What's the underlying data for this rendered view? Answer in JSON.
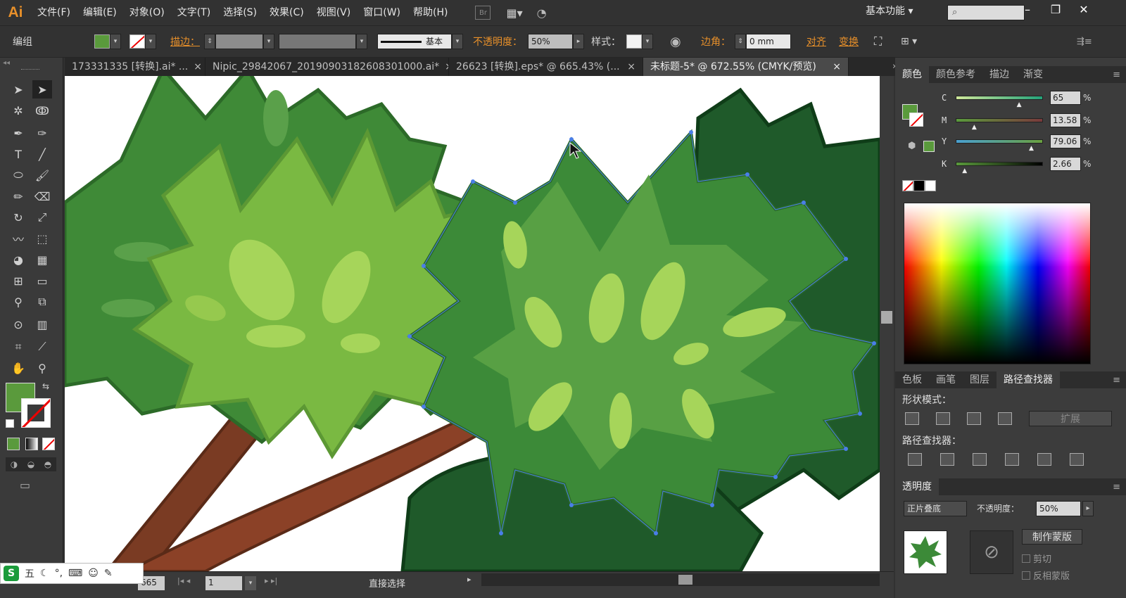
{
  "app": {
    "logo": "Ai"
  },
  "menu": [
    "文件(F)",
    "编辑(E)",
    "对象(O)",
    "文字(T)",
    "选择(S)",
    "效果(C)",
    "视图(V)",
    "窗口(W)",
    "帮助(H)"
  ],
  "menu_extra": {
    "br_label": "Br"
  },
  "workspace": {
    "label": "基本功能"
  },
  "control": {
    "group_label": "编组",
    "stroke_label": "描边：",
    "stroke_style": "基本",
    "opacity_label": "不透明度：",
    "opacity_value": "50%",
    "style_label": "样式：",
    "corner_label": "边角：",
    "corner_value": "0 mm",
    "align_label": "对齐",
    "transform_label": "变换",
    "fill_color": "#5a9a3c"
  },
  "tabs": [
    {
      "label": "173331335 [转换].ai* ...",
      "close": "×"
    },
    {
      "label": "Nipic_29842067_20190903182608301000.ai*",
      "close": "×"
    },
    {
      "label": "26623 [转换].eps* @ 665.43% (...",
      "close": "×"
    },
    {
      "label": "未标题-5* @ 672.55% (CMYK/预览)",
      "close": "×"
    }
  ],
  "color_panel": {
    "tabs": [
      "颜色",
      "颜色参考",
      "描边",
      "渐变"
    ],
    "sliders": [
      {
        "label": "C",
        "value": "65",
        "fraction": 0.65
      },
      {
        "label": "M",
        "value": "13.58",
        "fraction": 0.1358
      },
      {
        "label": "Y",
        "value": "79.06",
        "fraction": 0.7906
      },
      {
        "label": "K",
        "value": "2.66",
        "fraction": 0.0266
      }
    ],
    "percent": "%",
    "swatch_color": "#5a9a3c"
  },
  "pathfinder_panel": {
    "tabs": [
      "色板",
      "画笔",
      "图层",
      "路径查找器"
    ],
    "shape_modes_label": "形状模式：",
    "expand_label": "扩展",
    "pathfinders_label": "路径查找器："
  },
  "transparency_panel": {
    "title": "透明度",
    "mode": "正片叠底",
    "opacity_label": "不透明度：",
    "opacity_value": "50%",
    "make_mask": "制作蒙版",
    "clip": "剪切",
    "invert_mask": "反相蒙版"
  },
  "status": {
    "zoom": "665",
    "page": "1",
    "tool": "直接选择"
  },
  "ime": {
    "label": "五"
  }
}
